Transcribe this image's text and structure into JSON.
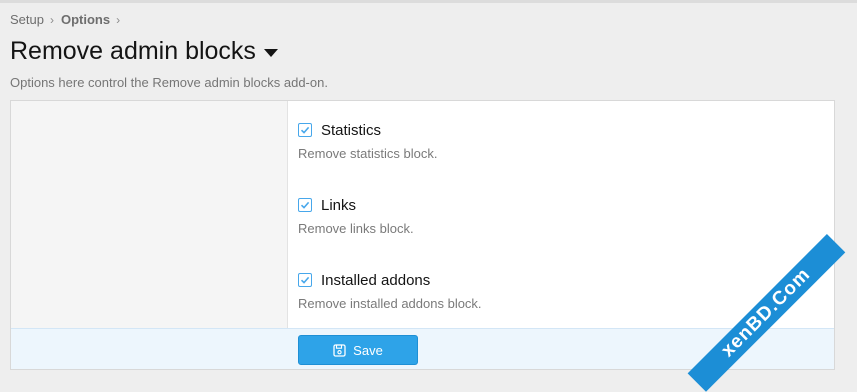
{
  "breadcrumb": {
    "items": [
      "Setup",
      "Options"
    ],
    "separator": "›"
  },
  "header": {
    "title": "Remove admin blocks",
    "description": "Options here control the Remove admin blocks add-on."
  },
  "options": [
    {
      "label": "Statistics",
      "hint": "Remove statistics block.",
      "checked": true
    },
    {
      "label": "Links",
      "hint": "Remove links block.",
      "checked": true
    },
    {
      "label": "Installed addons",
      "hint": "Remove installed addons block.",
      "checked": true
    }
  ],
  "footer": {
    "save_label": "Save"
  },
  "watermark": {
    "text": "xenBD.Com"
  },
  "colors": {
    "accent": "#2ea3e8",
    "footer_bg": "#edf6fd",
    "checkbox": "#47a7eb"
  }
}
